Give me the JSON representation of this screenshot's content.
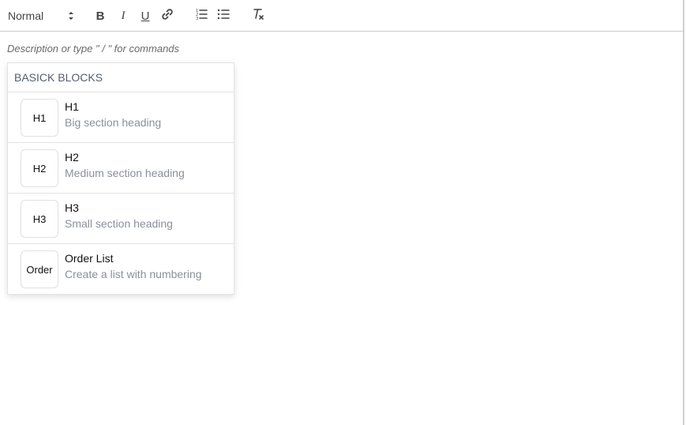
{
  "toolbar": {
    "header_select_value": "Normal",
    "bold_label": "B",
    "italic_label": "I",
    "underline_label": "U",
    "icons": [
      "chevron-updown-icon",
      "link-icon",
      "ordered-list-icon",
      "bullet-list-icon",
      "clear-format-icon"
    ]
  },
  "editor": {
    "placeholder": "Description or type \" / \" for commands"
  },
  "menu": {
    "header": "BASICK BLOCKS",
    "items": [
      {
        "badge": "H1",
        "title": "H1",
        "description": "Big section heading"
      },
      {
        "badge": "H2",
        "title": "H2",
        "description": "Medium section heading"
      },
      {
        "badge": "H3",
        "title": "H3",
        "description": "Small section heading"
      },
      {
        "badge": "Order",
        "title": "Order List",
        "description": "Create a list with numbering"
      }
    ]
  },
  "colors": {
    "text": "#111111",
    "muted": "#8a9099",
    "border": "#e3e3e3",
    "toolbar_icon": "#444444"
  }
}
